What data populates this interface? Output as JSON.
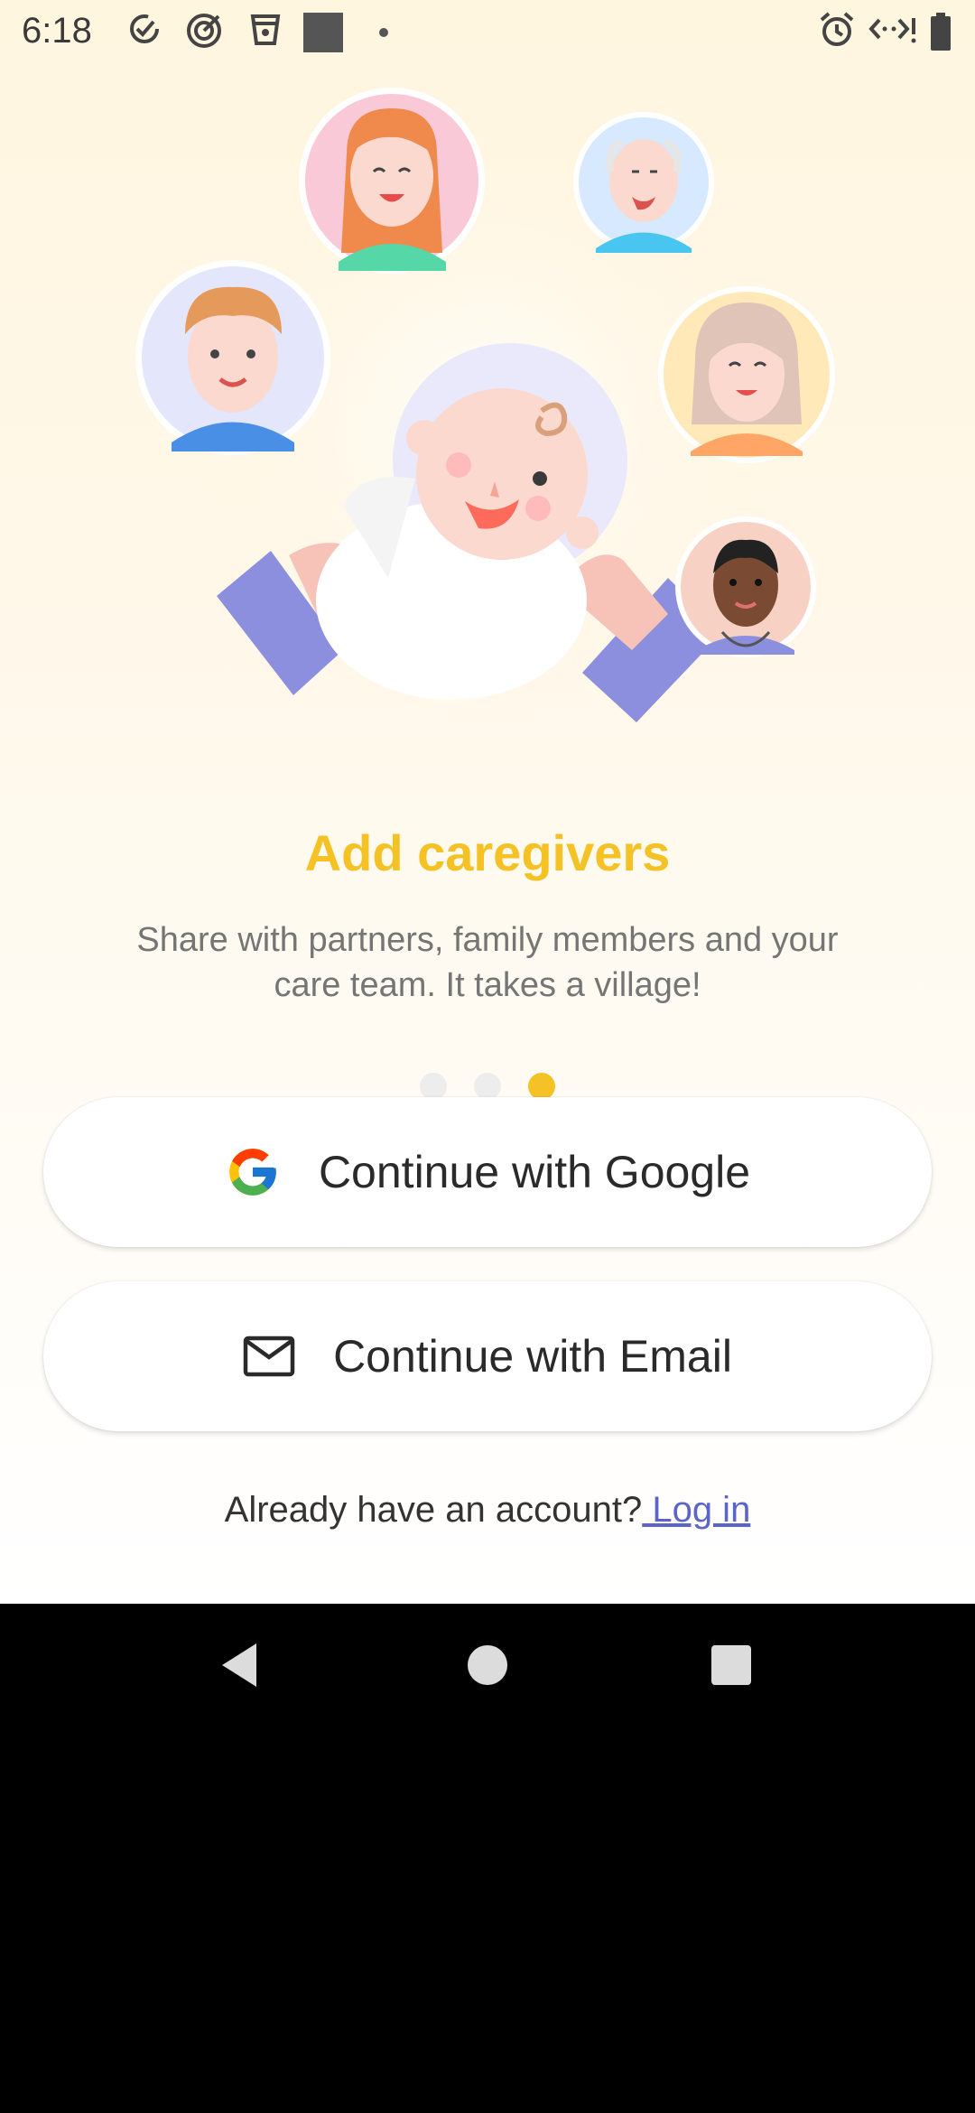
{
  "status_bar": {
    "time": "6:18",
    "left_icons": [
      "task-check-icon",
      "target-icon",
      "cup-icon",
      "square-app-icon",
      "dot-icon"
    ],
    "right_icons": [
      "alarm-icon",
      "data-sync-icon",
      "battery-icon"
    ]
  },
  "illustration": {
    "avatars": [
      "woman-red-hair",
      "bald-grandfather",
      "man-brown-hair",
      "grandmother",
      "doctor"
    ],
    "center": "baby-held-in-hands"
  },
  "onboarding": {
    "title": "Add caregivers",
    "subtitle": "Share with partners, family members and your care team. It takes a village!",
    "page_count": 3,
    "active_page": 3,
    "dot_colors": {
      "active": "#F5C226",
      "inactive": "#EDEDED"
    }
  },
  "actions": {
    "google_label": "Continue with Google",
    "email_label": "Continue with Email"
  },
  "login": {
    "prompt": "Already have an account?",
    "link": " Log in"
  },
  "colors": {
    "accent_yellow": "#F5C226",
    "link_purple": "#5B64C9",
    "sleeve_purple": "#8C8FDD"
  },
  "nav_bar": {
    "buttons": [
      "back-icon",
      "home-icon",
      "recents-icon"
    ]
  }
}
